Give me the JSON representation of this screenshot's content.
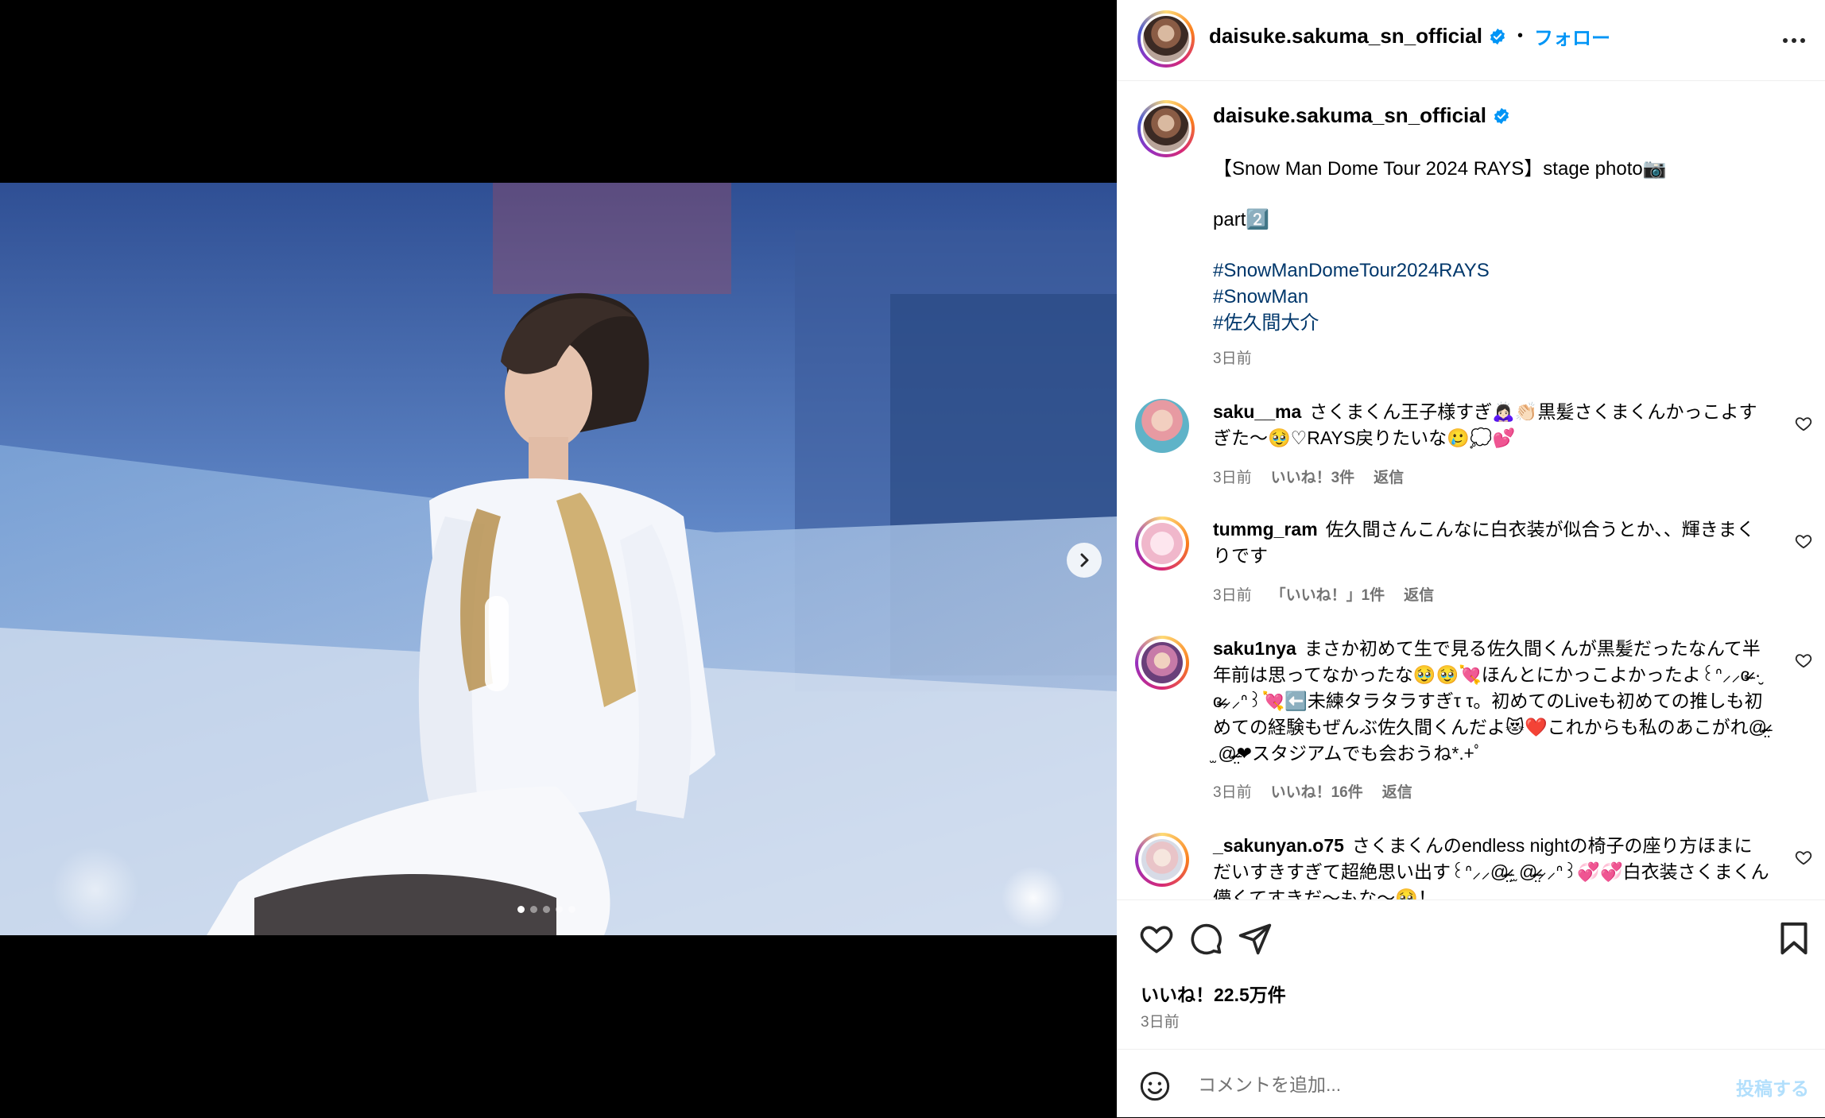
{
  "post": {
    "username": "daisuke.sakuma_sn_official",
    "follow_label": "フォロー",
    "header_dot": "•"
  },
  "caption": {
    "username": "daisuke.sakuma_sn_official",
    "line1": "【Snow Man Dome Tour 2024 RAYS】stage photo📷",
    "line2": "part2️⃣",
    "hashtags": [
      "#SnowManDomeTour2024RAYS",
      "#SnowMan",
      "#佐久間大介"
    ],
    "time": "3日前"
  },
  "comments": [
    {
      "username": "saku__ma",
      "text": "さくまくん王子様すぎ🙇🏻‍♀️👏🏻黒髪さくまくんかっこよすぎた〜🥹♡RAYS戻りたいな🥲💭💕",
      "time": "3日前",
      "likes": "いいね！3件",
      "reply": "返信"
    },
    {
      "username": "tummg_ram",
      "text": "佐久間さんこんなに白衣装が似合うとか、、輝きまくりです",
      "time": "3日前",
      "likes": "「いいね！」1件",
      "reply": "返信"
    },
    {
      "username": "saku1nya",
      "text": "まさか初めて生で見る佐久間くんが黒髪だったなんて半年前は思ってなかったな🥹🥹💘ほんとにかっこよかったよ꒰ᐢ⸝⸝ɞ̴̶̷ ·̮ ɞ̴̶̷⸝⸝ᐢ꒱💘⬅️未練タラタラすぎτ τ。初めてのLiveも初めての推しも初めての経験もぜんぶ佐久間くんだよ😻❤️これからも私のあこがれ@̴̶̷̤ ̫ @̴̶̷̤❤︎スタジアムでも会おうね*.+ﾟ",
      "time": "3日前",
      "likes": "いいね！16件",
      "reply": "返信"
    },
    {
      "username": "_sakunyan.o75",
      "text": "さくまくんのendless nightの椅子の座り方ほまにだいすきすぎて超絶思い出す꒰ᐢ⸝⸝@̴̶̷̤ ̫ @̴̶̷̤⸝⸝ᐢ꒱💞💞白衣装さくまくん儚くてすきだ〜もな〜🥹！",
      "time": "",
      "likes": "",
      "reply": ""
    }
  ],
  "footer": {
    "likes": "いいね！22.5万件",
    "time": "3日前",
    "comment_placeholder": "コメントを追加...",
    "post_label": "投稿する"
  },
  "carousel": {
    "total": 5,
    "current": 1
  },
  "icons": {
    "verified": "verified-badge-icon",
    "more": "more-options-icon",
    "heart": "heart-icon",
    "comment": "comment-icon",
    "share": "share-icon",
    "save": "bookmark-icon",
    "emoji": "emoji-icon",
    "next": "chevron-right-icon"
  },
  "colors": {
    "link": "#0095f6",
    "hashtag": "#00376b",
    "muted": "#737373"
  }
}
